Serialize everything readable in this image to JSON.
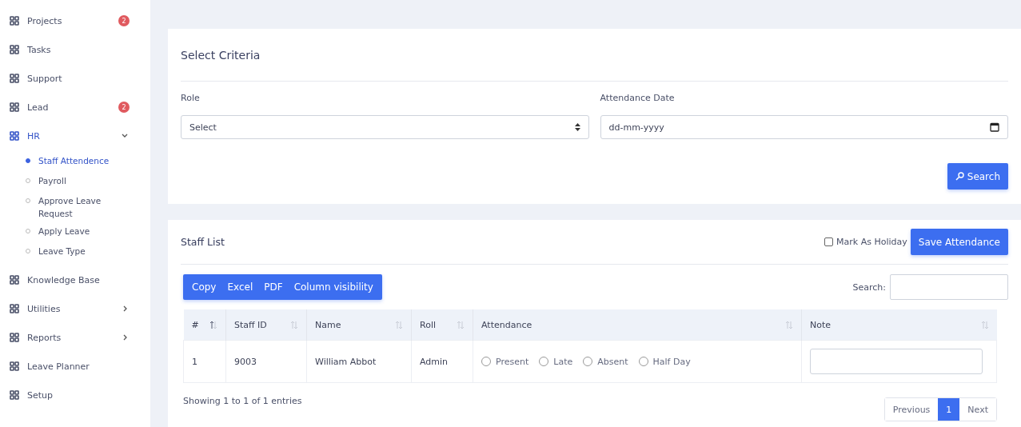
{
  "sidebar": {
    "items": [
      {
        "label": "Projects",
        "badge": "2",
        "selected": false
      },
      {
        "label": "Tasks",
        "selected": false
      },
      {
        "label": "Support",
        "selected": false
      },
      {
        "label": "Lead",
        "badge": "2",
        "selected": false
      },
      {
        "label": "HR",
        "selected": true,
        "expanded": true,
        "children": [
          {
            "label": "Staff Attendence",
            "selected": true
          },
          {
            "label": "Payroll",
            "selected": false
          },
          {
            "label": "Approve Leave Request",
            "selected": false
          },
          {
            "label": "Apply Leave",
            "selected": false
          },
          {
            "label": "Leave Type",
            "selected": false
          }
        ]
      },
      {
        "label": "Knowledge Base",
        "selected": false
      },
      {
        "label": "Utilities",
        "expanded": false,
        "selected": false
      },
      {
        "label": "Reports",
        "expanded": false,
        "selected": false
      },
      {
        "label": "Leave Planner",
        "selected": false
      },
      {
        "label": "Setup",
        "selected": false
      }
    ]
  },
  "criteria": {
    "title": "Select Criteria",
    "role": {
      "label": "Role",
      "value": "Select"
    },
    "date": {
      "label": "Attendance Date",
      "placeholder": "dd-mm-yyyy"
    },
    "search_button": "Search"
  },
  "staff_list": {
    "title": "Staff List",
    "holiday": {
      "label": "Mark As Holiday",
      "checked": false
    },
    "save_button": "Save Attendance",
    "export_buttons": [
      "Copy",
      "Excel",
      "PDF",
      "Column visibility"
    ],
    "search_label": "Search:",
    "table": {
      "columns": [
        {
          "label": "#",
          "sorted": true
        },
        {
          "label": "Staff ID",
          "sorted": false
        },
        {
          "label": "Name",
          "sorted": false
        },
        {
          "label": "Roll",
          "sorted": false
        },
        {
          "label": "Attendance",
          "sorted": false
        },
        {
          "label": "Note",
          "sorted": false
        }
      ],
      "rows": [
        {
          "number": "1",
          "staff_id": "9003",
          "name": "William Abbot",
          "roll": "Admin",
          "attendance": [
            {
              "label": "Present",
              "selected": false
            },
            {
              "label": "Late",
              "selected": false
            },
            {
              "label": "Absent",
              "selected": false
            },
            {
              "label": "Half Day",
              "selected": false
            }
          ]
        }
      ]
    },
    "info": "Showing 1 to 1 of 1 entries",
    "pagination": [
      {
        "label": "Previous",
        "selected": false
      },
      {
        "label": "1",
        "selected": true
      },
      {
        "label": "Next",
        "selected": false
      }
    ]
  }
}
